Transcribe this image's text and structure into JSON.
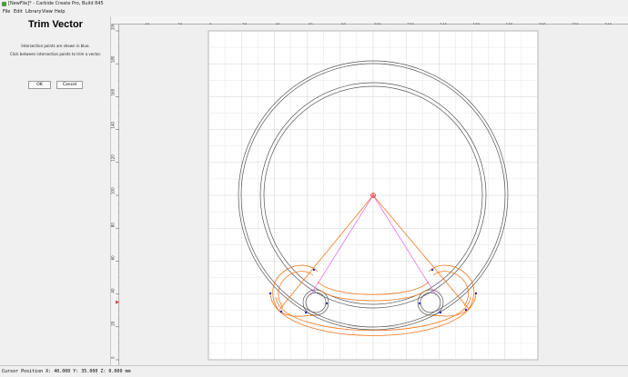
{
  "window": {
    "title": "[NewFile]* - Carbide Create Pro, Build 845"
  },
  "menu": {
    "items": [
      "File",
      "Edit",
      "Library",
      "View",
      "Help"
    ]
  },
  "panel": {
    "title": "Trim Vector",
    "message1": "Intersection points are shown in blue.",
    "message2": "Click between intersection points to trim a vector.",
    "ok_label": "OK",
    "cancel_label": "Cancel"
  },
  "ruler": {
    "x_ticks": [
      "-40",
      "-20",
      "0",
      "20",
      "40",
      "60",
      "80",
      "100",
      "120",
      "140",
      "160",
      "180",
      "200",
      "220",
      "240"
    ],
    "y_ticks": [
      "200",
      "180",
      "160",
      "140",
      "120",
      "100",
      "80",
      "60",
      "40",
      "20",
      "0"
    ],
    "cursor_x": 40,
    "cursor_y": 35
  },
  "status": {
    "text": "Cursor Position X: 40.000 Y: 35.000 Z: 0.000 mm"
  },
  "colors": {
    "vector": "#555555",
    "selected": "#f07820",
    "intersection": "#2030c0",
    "construction": "#e040e0",
    "ruler_marker": "#e04040"
  }
}
